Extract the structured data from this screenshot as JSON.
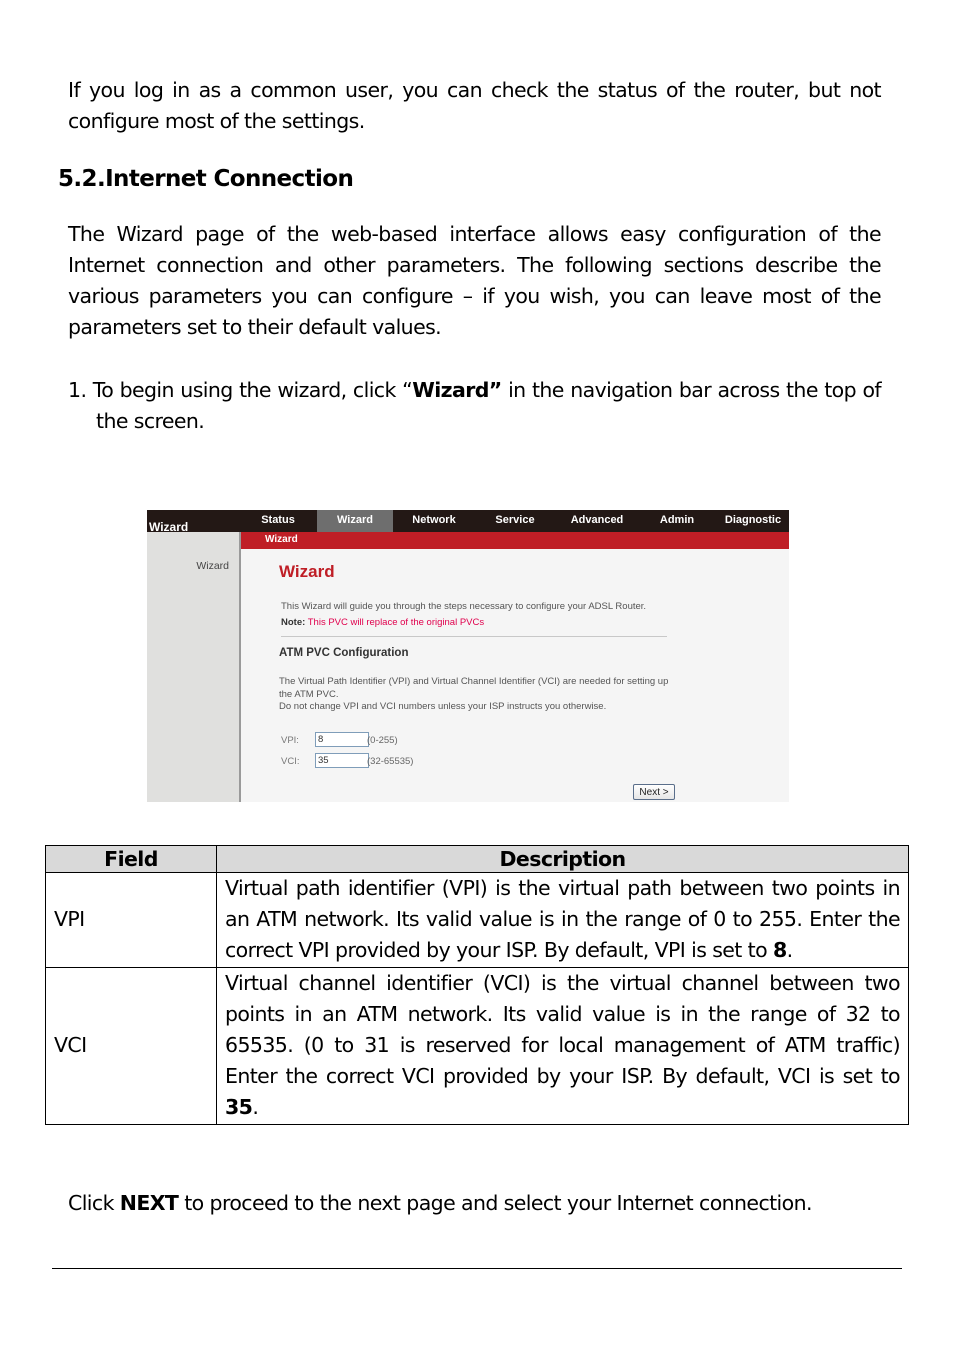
{
  "intro_paragraph": "If you log in as a common user, you can check the status of the router, but not configure most of the settings.",
  "section_heading": "5.2.Internet Connection",
  "section_paragraph": "The Wizard page of the web-based interface allows easy configuration of the Internet connection and other parameters. The following sections describe the various parameters you can configure – if you wish, you can leave most of the parameters set to their default values.",
  "step1": {
    "number": "1.",
    "before": "To begin using the wizard, click “",
    "bold": "Wizard”",
    "after": " in the navigation bar across the top of the screen."
  },
  "router_ui": {
    "brand": "Wizard",
    "nav": [
      {
        "label": "Status",
        "active": false
      },
      {
        "label": "Wizard",
        "active": true
      },
      {
        "label": "Network",
        "active": false
      },
      {
        "label": "Service",
        "active": false
      },
      {
        "label": "Advanced",
        "active": false
      },
      {
        "label": "Admin",
        "active": false
      },
      {
        "label": "Diagnostic",
        "active": false
      }
    ],
    "subnav_label": "Wizard",
    "sidebar_item": "Wizard",
    "page_title": "Wizard",
    "intro": "This Wizard will guide you through the steps necessary to configure your ADSL Router.",
    "note_label": "Note:",
    "note_text": " This PVC will replace of the original PVCs",
    "section_title": "ATM PVC Configuration",
    "desc_line1": "The Virtual Path Identifier (VPI) and Virtual Channel Identifier (VCI) are needed for setting up the ATM PVC.",
    "desc_line2": "Do not change VPI and VCI numbers unless your ISP instructs you otherwise.",
    "vpi": {
      "label": "VPI:",
      "value": "8",
      "range": "(0-255)"
    },
    "vci": {
      "label": "VCI:",
      "value": "35",
      "range": "(32-65535)"
    },
    "next_button": "Next >",
    "colors": {
      "topbar": "#231815",
      "accent": "#bf1e26",
      "active_tab": "#6e6e6e",
      "note": "#e0004d"
    }
  },
  "table": {
    "headers": [
      "Field",
      "Description"
    ],
    "rows": [
      {
        "field": "VPI",
        "desc_before": "Virtual path identifier (VPI) is the virtual path between two points in an ATM network. Its valid value is in the range of 0 to 255. Enter the correct VPI provided by your ISP. By default, VPI is set to ",
        "desc_bold": "8",
        "desc_after": "."
      },
      {
        "field": "VCI",
        "desc_before": "Virtual channel identifier (VCI) is the virtual channel between two points in an ATM network. Its valid value is in the range of 32 to 65535. (0 to 31 is reserved for local management of ATM traffic) Enter the correct VCI provided by your ISP. By default, VCI is set to ",
        "desc_bold": "35",
        "desc_after": "."
      }
    ]
  },
  "closing": {
    "before": "Click ",
    "bold": "NEXT",
    "after": " to proceed to the next page and select your Internet connection."
  }
}
